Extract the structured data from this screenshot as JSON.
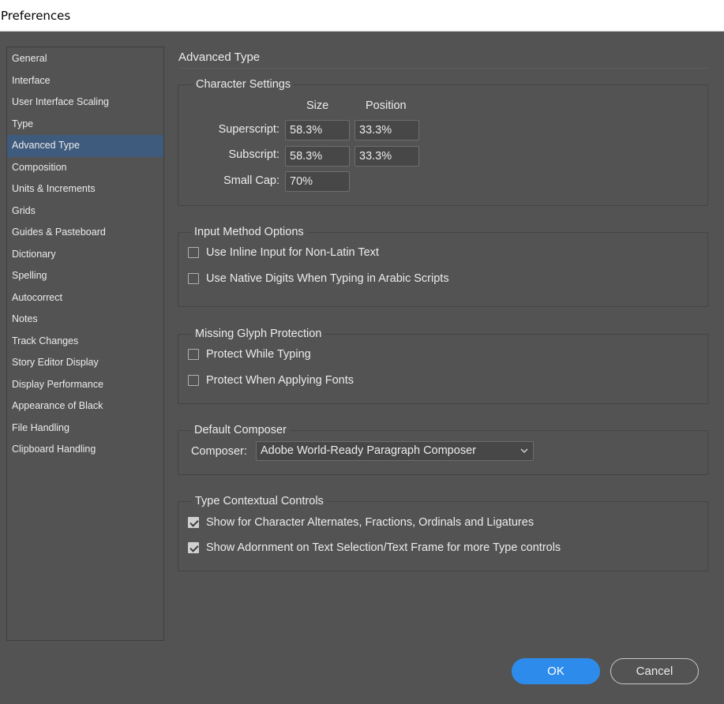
{
  "window": {
    "title": "Preferences"
  },
  "sidebar": {
    "items": [
      {
        "label": "General"
      },
      {
        "label": "Interface"
      },
      {
        "label": "User Interface Scaling"
      },
      {
        "label": "Type"
      },
      {
        "label": "Advanced Type",
        "selected": true
      },
      {
        "label": "Composition"
      },
      {
        "label": "Units & Increments"
      },
      {
        "label": "Grids"
      },
      {
        "label": "Guides & Pasteboard"
      },
      {
        "label": "Dictionary"
      },
      {
        "label": "Spelling"
      },
      {
        "label": "Autocorrect"
      },
      {
        "label": "Notes"
      },
      {
        "label": "Track Changes"
      },
      {
        "label": "Story Editor Display"
      },
      {
        "label": "Display Performance"
      },
      {
        "label": "Appearance of Black"
      },
      {
        "label": "File Handling"
      },
      {
        "label": "Clipboard Handling"
      }
    ]
  },
  "main": {
    "title": "Advanced Type",
    "character_settings": {
      "legend": "Character Settings",
      "col_size": "Size",
      "col_position": "Position",
      "superscript": {
        "label": "Superscript:",
        "size": "58.3%",
        "position": "33.3%"
      },
      "subscript": {
        "label": "Subscript:",
        "size": "58.3%",
        "position": "33.3%"
      },
      "small_cap": {
        "label": "Small Cap:",
        "size": "70%"
      }
    },
    "input_method": {
      "legend": "Input Method Options",
      "inline_input": {
        "label": "Use Inline Input for Non-Latin Text",
        "checked": false
      },
      "native_digits": {
        "label": "Use Native Digits When Typing in Arabic Scripts",
        "checked": false
      }
    },
    "glyph_protection": {
      "legend": "Missing Glyph Protection",
      "while_typing": {
        "label": "Protect While Typing",
        "checked": false
      },
      "applying_fonts": {
        "label": "Protect When Applying Fonts",
        "checked": false
      }
    },
    "composer": {
      "legend": "Default Composer",
      "label": "Composer:",
      "value": "Adobe World-Ready Paragraph Composer"
    },
    "contextual": {
      "legend": "Type Contextual Controls",
      "alternates": {
        "label": "Show for Character Alternates, Fractions, Ordinals and Ligatures",
        "checked": true
      },
      "adornment": {
        "label": "Show Adornment on Text Selection/Text Frame for more Type controls",
        "checked": true
      }
    }
  },
  "buttons": {
    "ok": "OK",
    "cancel": "Cancel"
  },
  "colors": {
    "accent": "#2d8ceb",
    "selection": "#3e5a7c",
    "background": "#535353"
  }
}
